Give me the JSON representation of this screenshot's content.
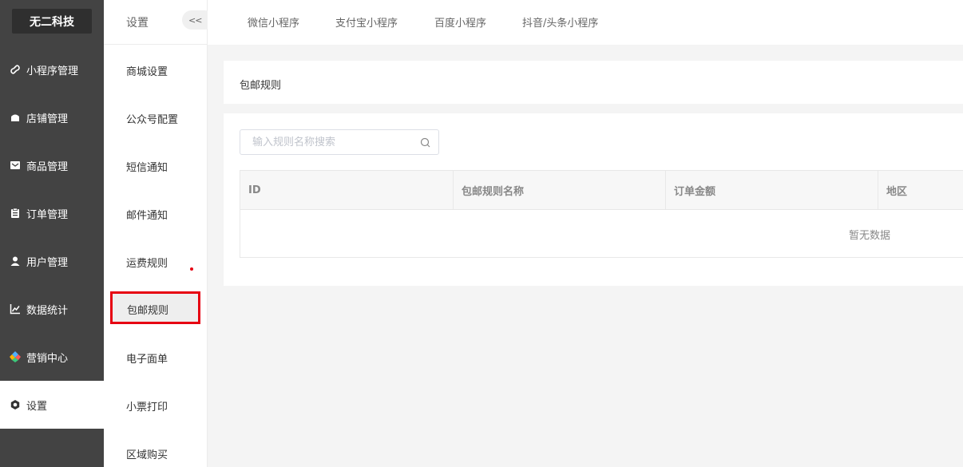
{
  "brand": {
    "logo_text": "无二科技"
  },
  "sidebar": {
    "items": [
      {
        "label": "小程序管理",
        "icon": "mini-program-icon"
      },
      {
        "label": "店铺管理",
        "icon": "store-icon"
      },
      {
        "label": "商品管理",
        "icon": "goods-icon"
      },
      {
        "label": "订单管理",
        "icon": "order-icon"
      },
      {
        "label": "用户管理",
        "icon": "user-icon"
      },
      {
        "label": "数据统计",
        "icon": "chart-icon"
      },
      {
        "label": "营销中心",
        "icon": "marketing-icon"
      },
      {
        "label": "设置",
        "icon": "settings-icon",
        "active": true
      }
    ]
  },
  "submenu": {
    "title": "设置",
    "collapse_label": "<<",
    "items": [
      {
        "label": "商城设置"
      },
      {
        "label": "公众号配置"
      },
      {
        "label": "短信通知"
      },
      {
        "label": "邮件通知"
      },
      {
        "label": "运费规则"
      },
      {
        "label": "包邮规则",
        "active": true
      },
      {
        "label": "电子面单"
      },
      {
        "label": "小票打印"
      },
      {
        "label": "区域购买"
      }
    ]
  },
  "tabs": [
    {
      "label": "微信小程序"
    },
    {
      "label": "支付宝小程序"
    },
    {
      "label": "百度小程序"
    },
    {
      "label": "抖音/头条小程序"
    }
  ],
  "page": {
    "title": "包邮规则",
    "search_placeholder": "输入规则名称搜索",
    "search_value": ""
  },
  "table": {
    "columns": [
      "ID",
      "包邮规则名称",
      "订单金额",
      "地区"
    ],
    "empty_text": "暂无数据"
  },
  "colors": {
    "sidebar_bg": "#434343",
    "highlight_border": "#e60012"
  }
}
